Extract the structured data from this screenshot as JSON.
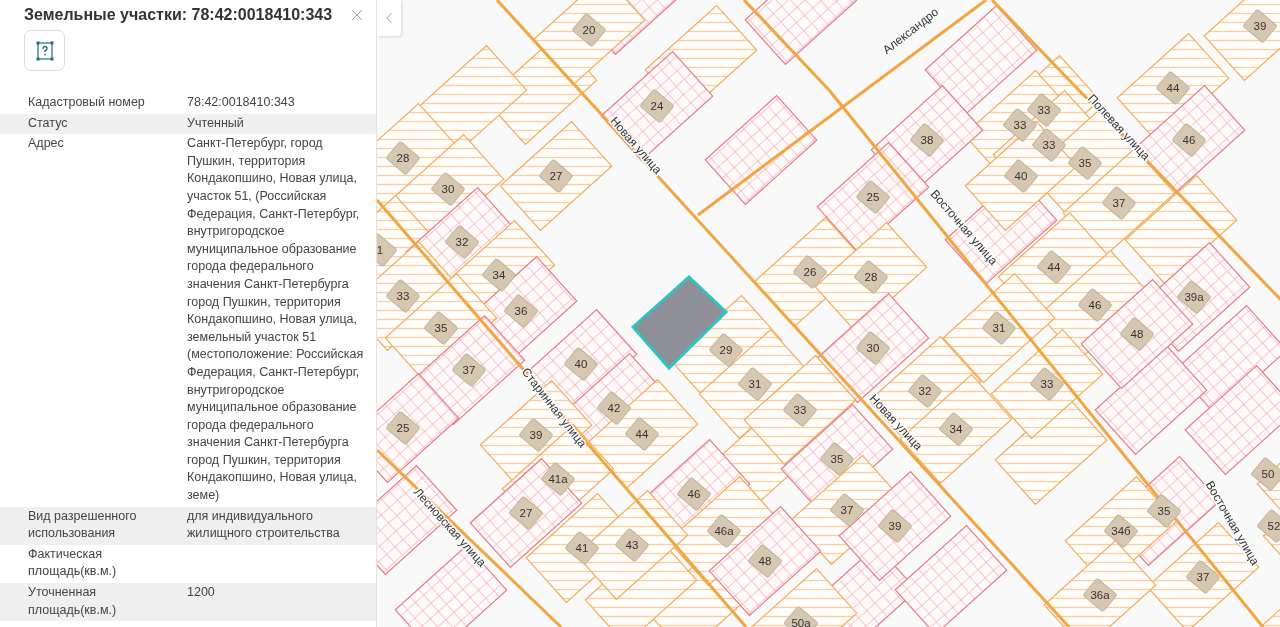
{
  "panel": {
    "title": "Земельные участки: 78:42:0018410:343",
    "rows": [
      {
        "label": "Кадастровый номер",
        "value": "78:42:0018410:343"
      },
      {
        "label": "Статус",
        "value": "Учтенный"
      },
      {
        "label": "Адрес",
        "value": "Санкт-Петербург, город Пушкин, территория Кондакопшино, Новая улица, участок 51, (Российская Федерация, Санкт-Петербург, внутригородское муниципальное образование города федерального значения Санкт-Петербурга город Пушкин, территория Кондакопшино, Новая улица, земельный участок 51 (местоположение: Российская Федерация, Санкт-Петербург, внутригородское муниципальное образование города федерального значения Санкт-Петербурга город Пушкин, территория Кондакопшино, Новая улица, земе)"
      },
      {
        "label": "Вид разрешенного использования",
        "value": "для индивидуального жилищного строительства"
      },
      {
        "label": "Фактическая площадь(кв.м.)"
      },
      {
        "label": "Уточненная площадь(кв.м.)",
        "value": "1200"
      }
    ]
  },
  "map": {
    "streets": [
      "Новая улица",
      "Александро",
      "Полевая улица",
      "Восточная улица",
      "Старинная улица",
      "Новая улица",
      "Лесновская улица",
      "Восточная улица"
    ],
    "buildings": [
      "20",
      "39",
      "44",
      "24",
      "33",
      "33",
      "38",
      "33",
      "46",
      "28",
      "35",
      "27",
      "40",
      "30",
      "25",
      "37",
      "1",
      "32",
      "34",
      "26",
      "28",
      "44",
      "33",
      "36",
      "46",
      "39а",
      "35",
      "31",
      "48",
      "29",
      "30",
      "37",
      "40",
      "31",
      "32",
      "33",
      "42",
      "33",
      "25",
      "39",
      "44",
      "34",
      "35",
      "41а",
      "50",
      "46",
      "27",
      "37",
      "35",
      "46а",
      "39",
      "34б",
      "52",
      "41",
      "43",
      "48",
      "37",
      "36а",
      "50а"
    ]
  }
}
